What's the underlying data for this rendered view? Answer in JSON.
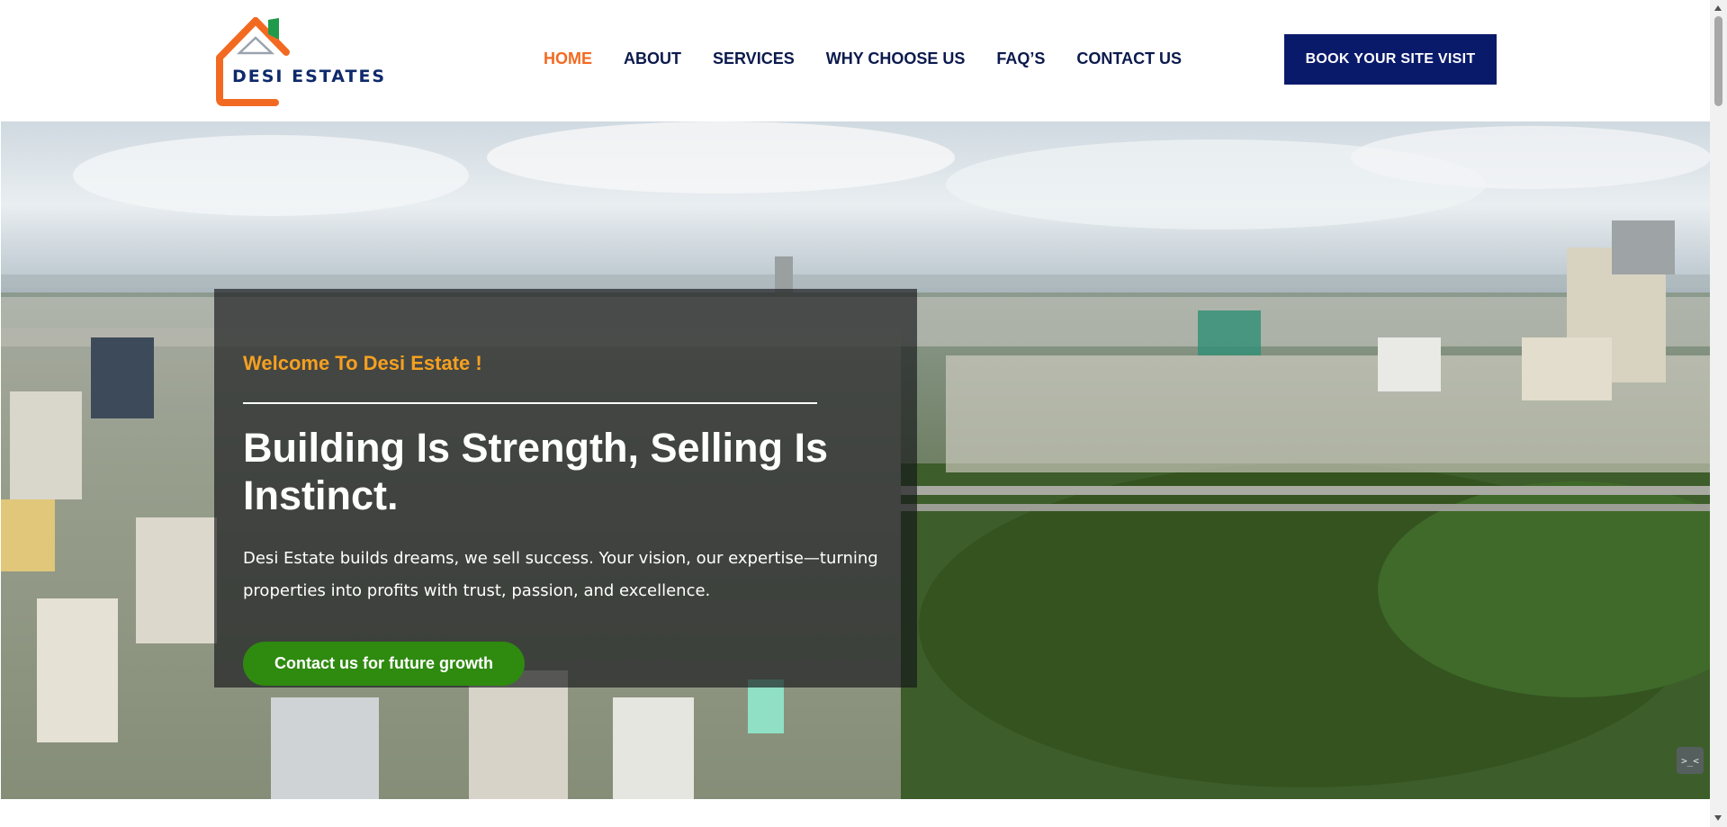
{
  "header": {
    "logo_text": "DESI ESTATES",
    "nav": [
      {
        "label": "HOME",
        "active": true
      },
      {
        "label": "ABOUT",
        "active": false
      },
      {
        "label": "SERVICES",
        "active": false
      },
      {
        "label": "WHY CHOOSE US",
        "active": false
      },
      {
        "label": "FAQ’S",
        "active": false
      },
      {
        "label": "CONTACT US",
        "active": false
      }
    ],
    "cta_label": "BOOK YOUR SITE VISIT"
  },
  "hero": {
    "welcome": "Welcome To Desi Estate !",
    "title": "Building Is Strength, Selling Is Instinct.",
    "description": "Desi Estate builds dreams, we sell success. Your vision, our expertise—turning properties into profits with trust, passion, and excellence.",
    "button_label": "Contact us for future growth",
    "background": "aerial-city-photo",
    "widget_glyph": ">_<"
  },
  "colors": {
    "nav_active": "#f26a21",
    "nav_text": "#0b1a4d",
    "book_button": "#0a1a6b",
    "welcome_text": "#f5a020",
    "cta_button": "#2f8a10",
    "logo_orange": "#f26a21",
    "logo_green": "#1f9a4a"
  }
}
